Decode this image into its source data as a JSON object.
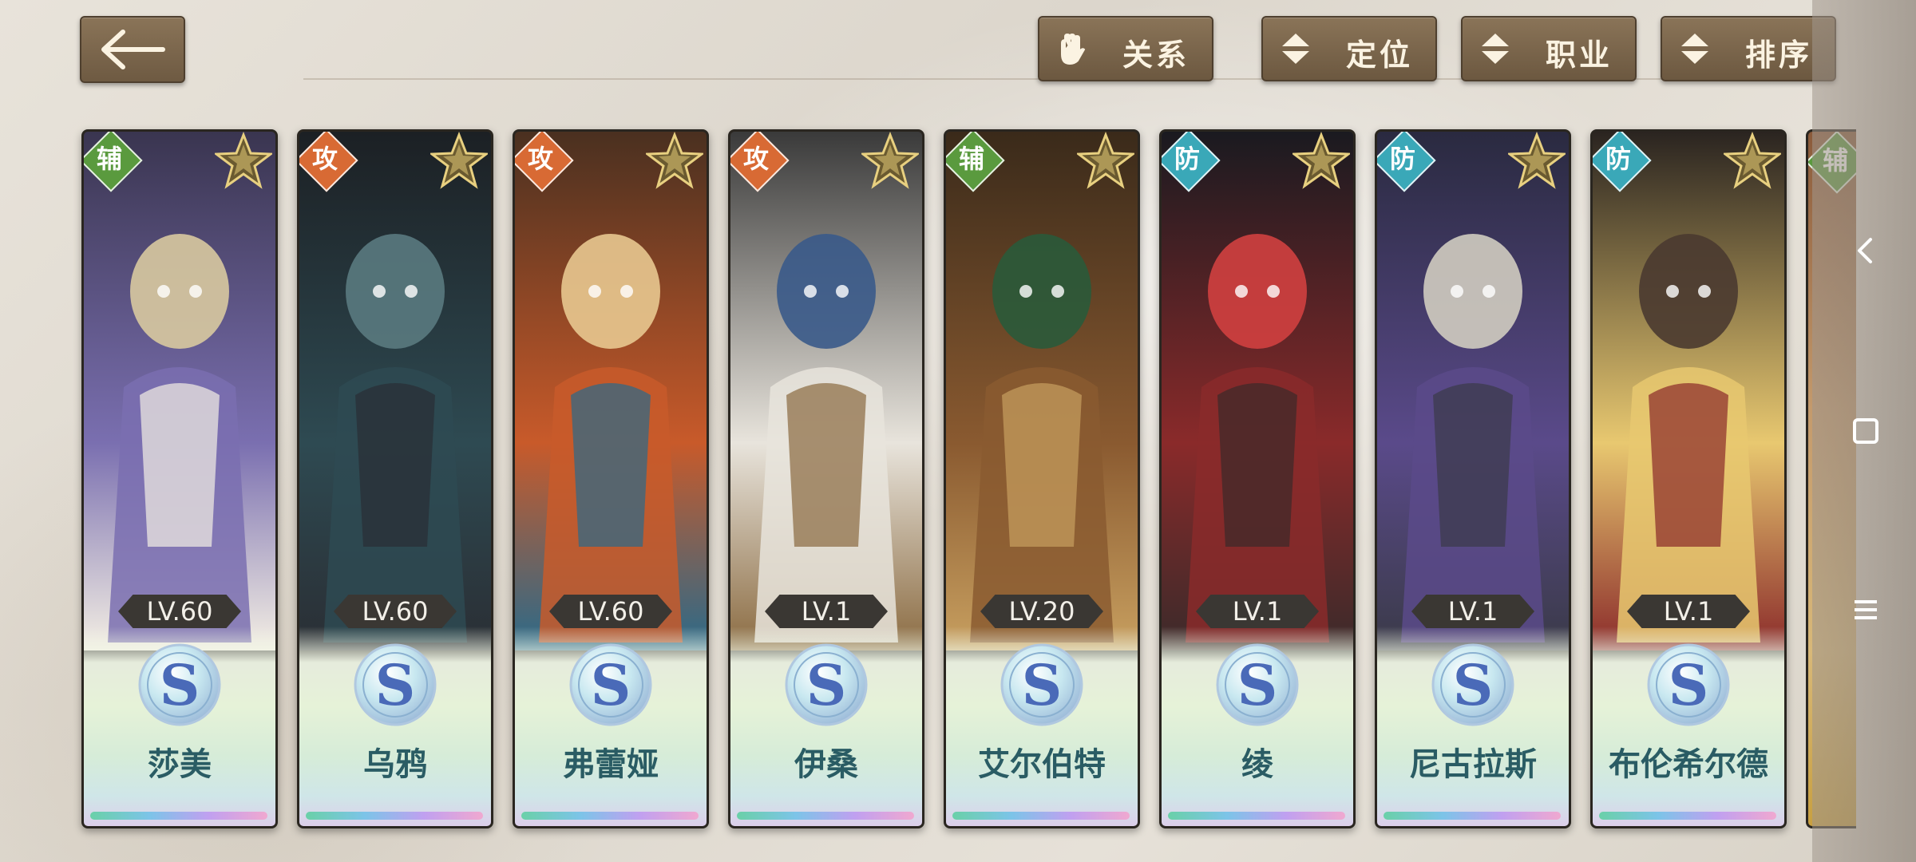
{
  "toolbar": {
    "back_label": "",
    "buttons": [
      {
        "label": "关系",
        "icon": "hand-icon"
      },
      {
        "label": "定位",
        "icon": "sort-arrows-icon"
      },
      {
        "label": "职业",
        "icon": "sort-arrows-icon"
      },
      {
        "label": "排序",
        "icon": "sort-arrows-icon"
      }
    ]
  },
  "colors": {
    "role_support": "#5a9a3e",
    "role_attack": "#d86a34",
    "role_defense": "#3aa8b8",
    "button_bg": "#7a6650",
    "name_text": "#2a5c64"
  },
  "cards": [
    {
      "role": "辅",
      "role_type": "support",
      "level": "LV.60",
      "rank": "S",
      "name": "莎美"
    },
    {
      "role": "攻",
      "role_type": "attack",
      "level": "LV.60",
      "rank": "S",
      "name": "乌鸦"
    },
    {
      "role": "攻",
      "role_type": "attack",
      "level": "LV.60",
      "rank": "S",
      "name": "弗蕾娅"
    },
    {
      "role": "攻",
      "role_type": "attack",
      "level": "LV.1",
      "rank": "S",
      "name": "伊桑"
    },
    {
      "role": "辅",
      "role_type": "support",
      "level": "LV.20",
      "rank": "S",
      "name": "艾尔伯特"
    },
    {
      "role": "防",
      "role_type": "defense",
      "level": "LV.1",
      "rank": "S",
      "name": "绫"
    },
    {
      "role": "防",
      "role_type": "defense",
      "level": "LV.1",
      "rank": "S",
      "name": "尼古拉斯"
    },
    {
      "role": "防",
      "role_type": "defense",
      "level": "LV.1",
      "rank": "S",
      "name": "布伦希尔德"
    }
  ],
  "partial_card": {
    "role": "辅"
  },
  "nav": {
    "items": [
      "back-nav-icon",
      "home-square-icon",
      "menu-lines-icon"
    ]
  }
}
